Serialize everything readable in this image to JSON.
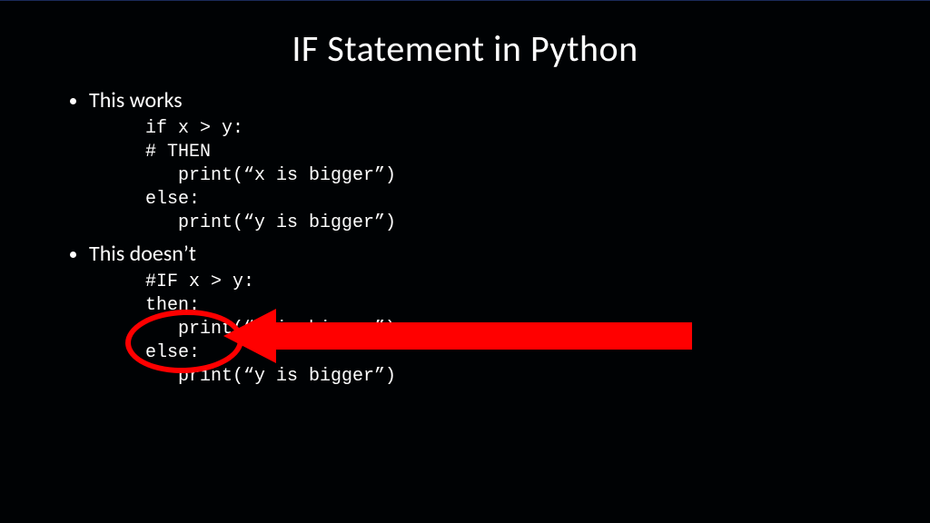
{
  "title": "IF Statement in Python",
  "bullets": {
    "works": "This works",
    "doesnt": "This doesn’t"
  },
  "code_works": "if x > y:\n# THEN\n   print(“x is bigger”)\nelse:\n   print(“y is bigger”)",
  "code_doesnt": "#IF x > y:\nthen:\n   print(“x is bigger”)\nelse:\n   print(“y is bigger”)",
  "annotation": {
    "type": "error-highlight",
    "target_lines": [
      "#IF x > y:",
      "then:"
    ],
    "shapes": [
      "red-ellipse",
      "red-left-arrow"
    ]
  }
}
